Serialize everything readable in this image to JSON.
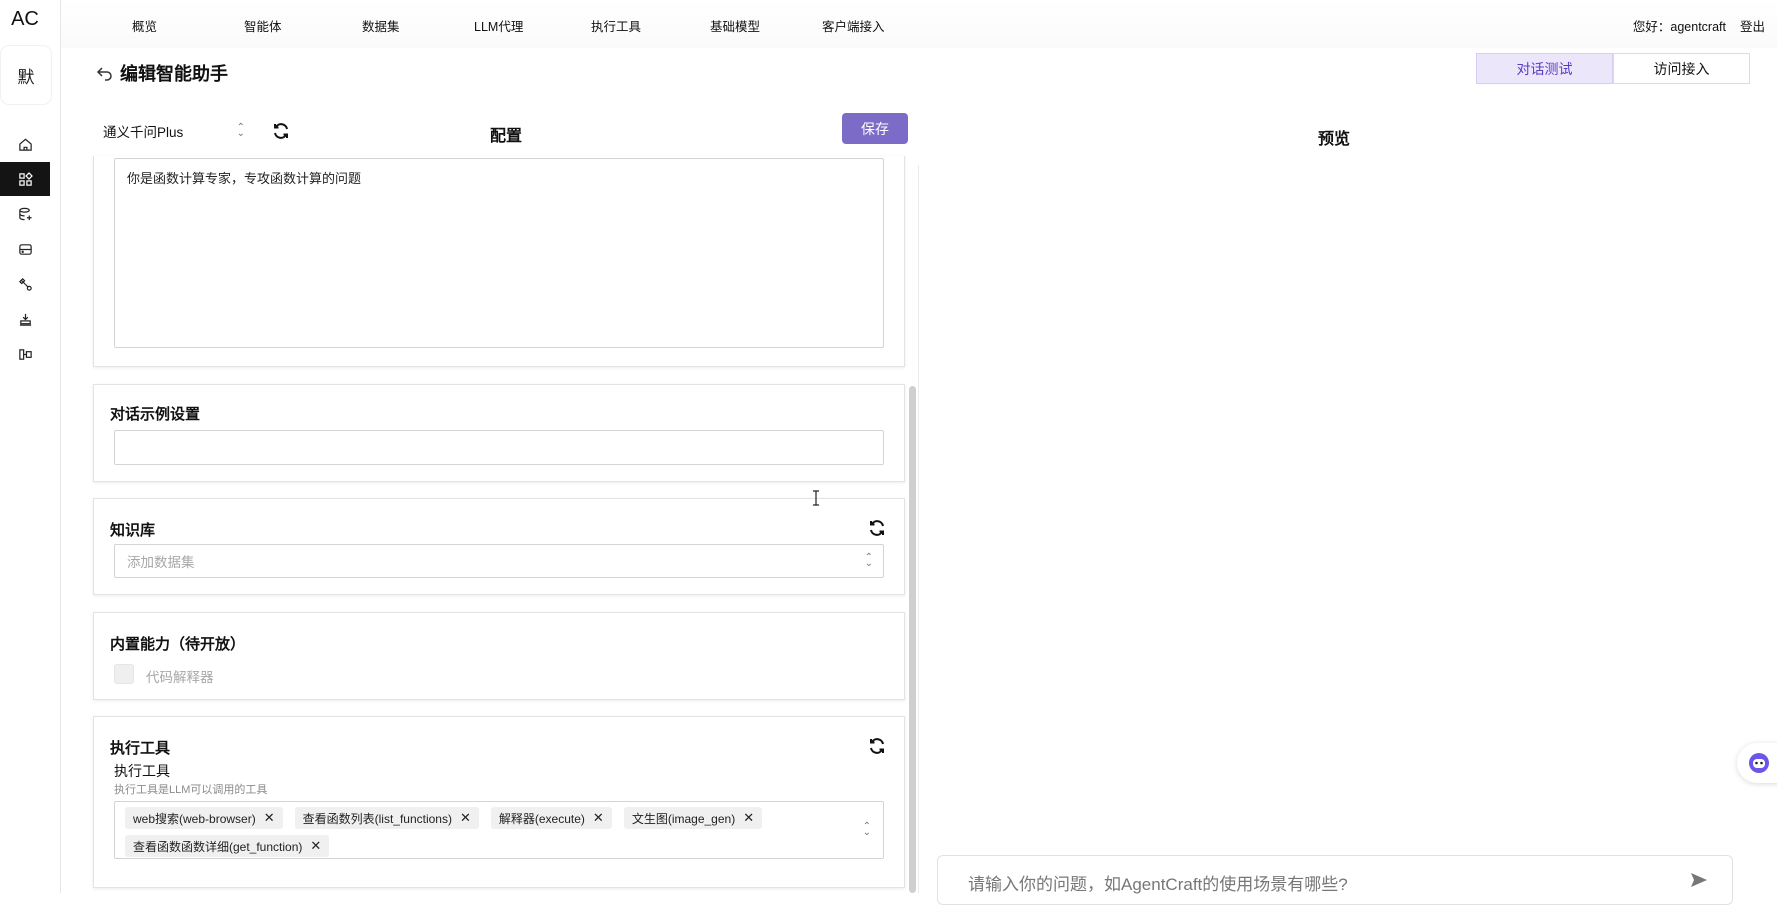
{
  "app": {
    "logo": "AC",
    "workspace_avatar": "默"
  },
  "rail": {
    "items": [
      {
        "icon": "home-icon"
      },
      {
        "icon": "agent-grid-icon",
        "active": true
      },
      {
        "icon": "dataset-icon"
      },
      {
        "icon": "proxy-icon"
      },
      {
        "icon": "tool-icon"
      },
      {
        "icon": "model-icon"
      },
      {
        "icon": "client-icon"
      }
    ]
  },
  "topnav": {
    "items": [
      "概览",
      "智能体",
      "数据集",
      "LLM代理",
      "执行工具",
      "基础模型",
      "客户端接入"
    ],
    "greeting": "您好：agentcraft",
    "logout": "登出"
  },
  "page": {
    "title": "编辑智能助手",
    "tabs": [
      {
        "label": "对话测试",
        "active": true
      },
      {
        "label": "访问接入",
        "active": false
      }
    ]
  },
  "config": {
    "model_value": "通义千问Plus",
    "title": "配置",
    "save_label": "保存",
    "system_prompt": "你是函数计算专家，专攻函数计算的问题",
    "examples": {
      "title": "对话示例设置",
      "value": ""
    },
    "knowledge": {
      "title": "知识库",
      "placeholder": "添加数据集"
    },
    "builtin": {
      "title": "内置能力（待开放）",
      "code_interpreter": "代码解释器"
    },
    "tools": {
      "title": "执行工具",
      "field_label": "执行工具",
      "field_desc": "执行工具是LLM可以调用的工具",
      "tags": [
        "web搜索(web-browser)",
        "查看函数列表(list_functions)",
        "解释器(execute)",
        "文生图(image_gen)",
        "查看函数函数详细(get_function)"
      ]
    }
  },
  "preview": {
    "title": "预览",
    "input_placeholder": "请输入你的问题，如AgentCraft的使用场景有哪些?"
  },
  "colors": {
    "accent": "#7c6bc7",
    "tab_active_bg": "#ece6fb",
    "rail_active": "#141414"
  }
}
